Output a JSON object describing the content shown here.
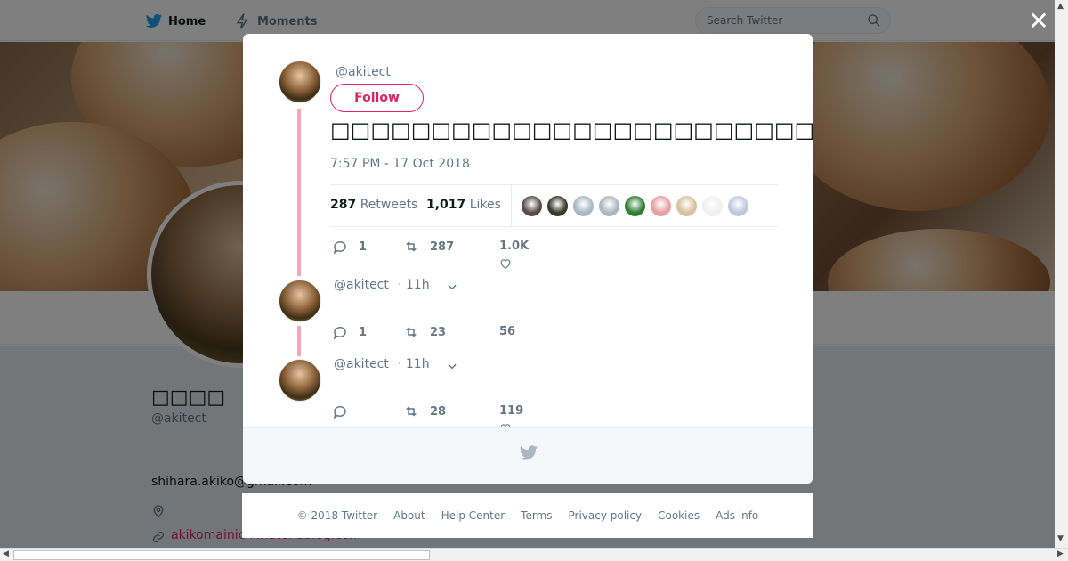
{
  "nav": {
    "home_label": "Home",
    "moments_label": "Moments",
    "search_placeholder": "Search Twitter"
  },
  "profile": {
    "name": "□□□□",
    "handle": "@akitect",
    "email": "shihara.akiko@gmail.com",
    "link": "akikomainichi.hatenablog.com"
  },
  "modal": {
    "main_tweet": {
      "handle": "@akitect",
      "follow_label": "Follow",
      "text": "□□□□□□□□□□□□□□□□□□□□□□□□□□□□□□□□□□□□□□□□□□□□□□□□□□",
      "timestamp": "7:57 PM - 17 Oct 2018",
      "retweets_count": "287",
      "retweets_label": "Retweets",
      "likes_count": "1,017",
      "likes_label": "Likes",
      "reply_count": "1",
      "retweet_count": "287",
      "like_count": "1.0K",
      "likers": [
        "#5a4a4a",
        "#3a3a2a",
        "#aab8c2",
        "#aab8c2",
        "#2e7d32",
        "#e8a0a0",
        "#d8c0a0",
        "#f0f0f0",
        "#c0c8e0"
      ]
    },
    "replies": [
      {
        "handle": "@akitect",
        "time": "· 11h",
        "reply_count": "1",
        "retweet_count": "23",
        "like_count": "56"
      },
      {
        "handle": "@akitect",
        "time": "· 11h",
        "reply_count": "",
        "retweet_count": "28",
        "like_count": "119"
      }
    ]
  },
  "footer": {
    "copyright": "© 2018 Twitter",
    "about": "About",
    "help": "Help Center",
    "terms": "Terms",
    "privacy": "Privacy policy",
    "cookies": "Cookies",
    "ads": "Ads info"
  },
  "colors": {
    "brand": "#1da1f2",
    "accent": "#e0245e",
    "thread": "#f4a8b8"
  }
}
